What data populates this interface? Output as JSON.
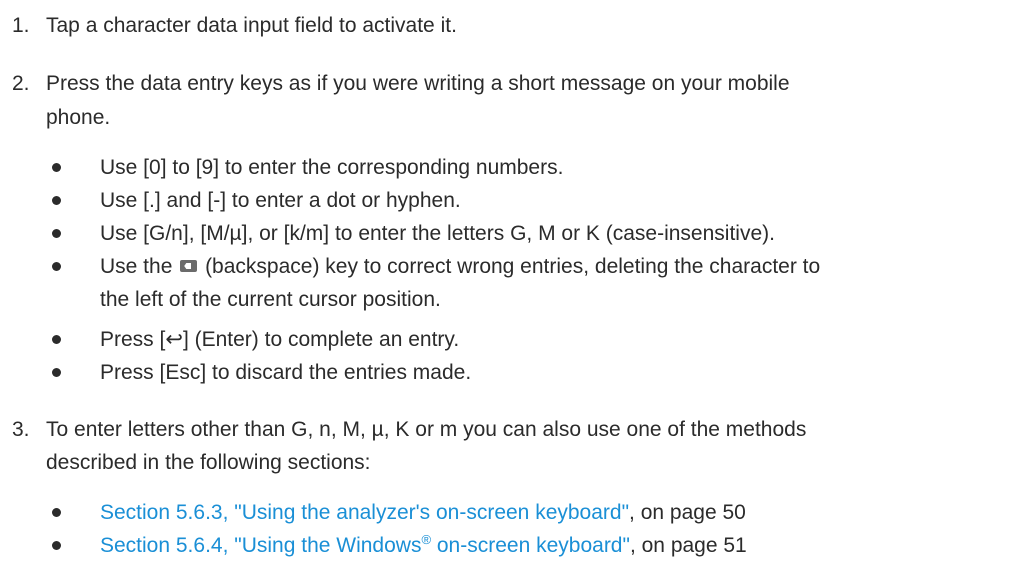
{
  "steps": [
    {
      "number": "1.",
      "text": "Tap a character data input field to activate it."
    },
    {
      "number": "2.",
      "line1": "Press the data entry keys as if you were writing a short message on your mobile",
      "line2": "phone.",
      "bullets": [
        "Use [0] to [9] to enter the corresponding numbers.",
        "Use [.] and [-] to enter a dot or hyphen.",
        "Use [G/n], [M/µ], or [k/m] to enter the letters G, M or K (case-insensitive).",
        {
          "prefix": "Use the",
          "icon": "backspace-key-icon",
          "suffix": "(backspace) key to correct wrong entries, deleting the character to",
          "line2": "the left of the current cursor position."
        },
        "Press [↩] (Enter) to complete an entry.",
        "Press [Esc] to discard the entries made."
      ]
    },
    {
      "number": "3.",
      "line1": "To enter letters other than G, n, M, µ, K or m you can also use one of the methods",
      "line2": "described in the following sections:",
      "links": [
        {
          "link_text": "Section 5.6.3, \"Using the analyzer's on-screen keyboard\"",
          "suffix": ", on page 50"
        },
        {
          "link_text_pre": "Section 5.6.4, \"Using the Windows",
          "link_sup": "®",
          "link_text_post": " on-screen keyboard\"",
          "suffix": ", on page 51"
        }
      ]
    }
  ],
  "colors": {
    "text": "#2b2b2b",
    "link": "#1a8fd6"
  }
}
